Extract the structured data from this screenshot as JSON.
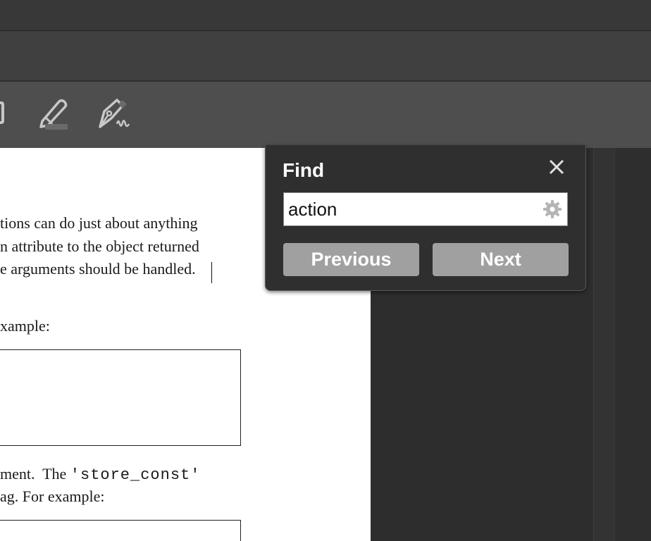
{
  "document": {
    "lines": [
      "tions can do just about anything",
      "n attribute to the object returned",
      "e arguments should be handled.",
      "xample:",
      "ment.  The ",
      "'store_const'",
      "ag. For example:"
    ]
  },
  "find": {
    "title": "Find",
    "search_value": "action",
    "previous_label": "Previous",
    "next_label": "Next"
  },
  "icons": {
    "close": "close-icon",
    "settings": "gear-icon",
    "highlight": "highlighter-icon",
    "sign": "signature-pen-icon"
  },
  "colors": {
    "panel_bg": "#2f2f2f",
    "button_bg": "#a0a0a0",
    "toolbar_bg": "#4e4e4e"
  }
}
